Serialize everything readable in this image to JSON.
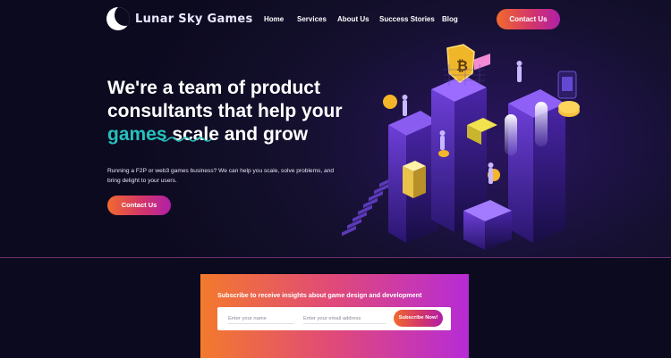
{
  "brand": {
    "name": "Lunar Sky Games"
  },
  "nav": {
    "items": [
      {
        "label": "Home"
      },
      {
        "label": "Services"
      },
      {
        "label": "About Us"
      },
      {
        "label": "Success Stories"
      },
      {
        "label": "Blog"
      }
    ],
    "cta_label": "Contact Us"
  },
  "hero": {
    "headline_before": "We're a team of product consultants that help your",
    "headline_highlight": "games",
    "headline_after": "scale and grow",
    "subtext": "Running a F2P or web3 games business? We can help you scale, solve problems, and bring delight to your users.",
    "cta_label": "Contact Us"
  },
  "subscribe": {
    "title": "Subscribe to receive insights about game design and development",
    "name_placeholder": "Enter your name",
    "email_placeholder": "Enter your email address",
    "button_label": "Subscribe Now!"
  },
  "colors": {
    "accent_teal": "#25c2bd",
    "gradient_start": "#f26a2e",
    "gradient_end": "#b11fa8",
    "background": "#0b0a1e"
  },
  "icons": [
    "logo-icon",
    "bitcoin-icon",
    "coin-icon"
  ]
}
